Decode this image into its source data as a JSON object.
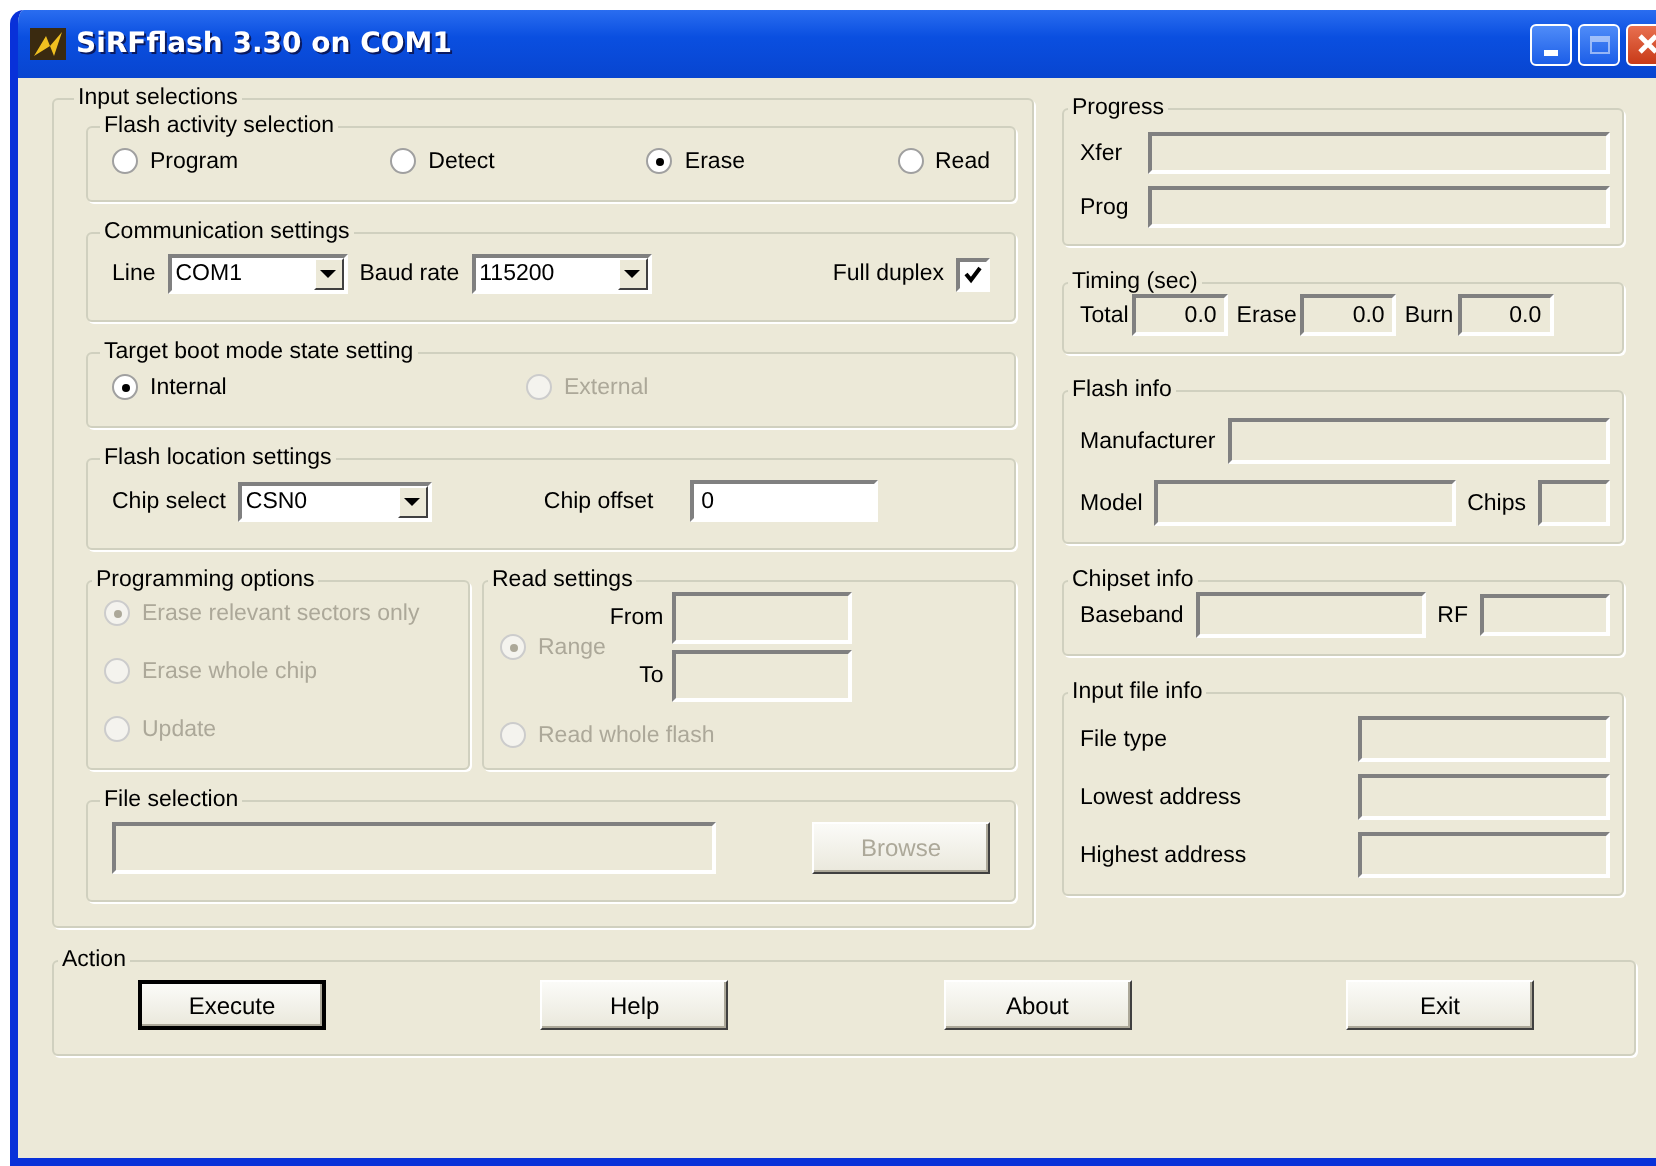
{
  "window": {
    "title": "SiRFflash 3.30 on COM1"
  },
  "input_selections": {
    "legend": "Input selections",
    "flash_activity": {
      "legend": "Flash activity selection",
      "options": [
        {
          "label": "Program",
          "selected": false,
          "disabled": false
        },
        {
          "label": "Detect",
          "selected": false,
          "disabled": false
        },
        {
          "label": "Erase",
          "selected": true,
          "disabled": false
        },
        {
          "label": "Read",
          "selected": false,
          "disabled": false
        }
      ]
    },
    "communication": {
      "legend": "Communication settings",
      "line": {
        "label": "Line",
        "value": "COM1"
      },
      "baud_rate": {
        "label": "Baud rate",
        "value": "115200"
      },
      "full_duplex": {
        "label": "Full duplex",
        "checked": true
      }
    },
    "boot_mode": {
      "legend": "Target boot mode state setting",
      "options": [
        {
          "label": "Internal",
          "selected": true,
          "disabled": false
        },
        {
          "label": "External",
          "selected": false,
          "disabled": true
        }
      ]
    },
    "flash_location": {
      "legend": "Flash location settings",
      "chip_select": {
        "label": "Chip select",
        "value": "CSN0"
      },
      "chip_offset": {
        "label": "Chip offset",
        "value": "0"
      }
    },
    "programming_options": {
      "legend": "Programming options",
      "options": [
        {
          "label": "Erase relevant sectors only",
          "selected": true,
          "disabled": true
        },
        {
          "label": "Erase whole chip",
          "selected": false,
          "disabled": true
        },
        {
          "label": "Update",
          "selected": false,
          "disabled": true
        }
      ]
    },
    "read_settings": {
      "legend": "Read settings",
      "range": {
        "label": "Range",
        "selected": true,
        "disabled": true
      },
      "from_label": "From",
      "to_label": "To",
      "whole": {
        "label": "Read whole flash",
        "selected": false,
        "disabled": true
      }
    },
    "file_selection": {
      "legend": "File selection",
      "browse": {
        "label": "Browse",
        "disabled": true
      }
    }
  },
  "progress": {
    "legend": "Progress",
    "bars": [
      {
        "label": "Xfer",
        "level": 0
      },
      {
        "label": "Prog",
        "level": 0
      }
    ]
  },
  "timing": {
    "legend": "Timing (sec)",
    "fields": [
      {
        "label": "Total",
        "value": "0.0"
      },
      {
        "label": "Erase",
        "value": "0.0"
      },
      {
        "label": "Burn",
        "value": "0.0"
      }
    ]
  },
  "flash_info": {
    "legend": "Flash info",
    "manufacturer_label": "Manufacturer",
    "model_label": "Model",
    "chips_label": "Chips"
  },
  "chipset_info": {
    "legend": "Chipset info",
    "baseband_label": "Baseband",
    "rf_label": "RF"
  },
  "input_file_info": {
    "legend": "Input file info",
    "fields": [
      {
        "label": "File type"
      },
      {
        "label": "Lowest address"
      },
      {
        "label": "Highest address"
      }
    ]
  },
  "action": {
    "legend": "Action",
    "buttons": [
      {
        "label": "Execute",
        "default": true
      },
      {
        "label": "Help",
        "default": false
      },
      {
        "label": "About",
        "default": false
      },
      {
        "label": "Exit",
        "default": false
      }
    ]
  }
}
